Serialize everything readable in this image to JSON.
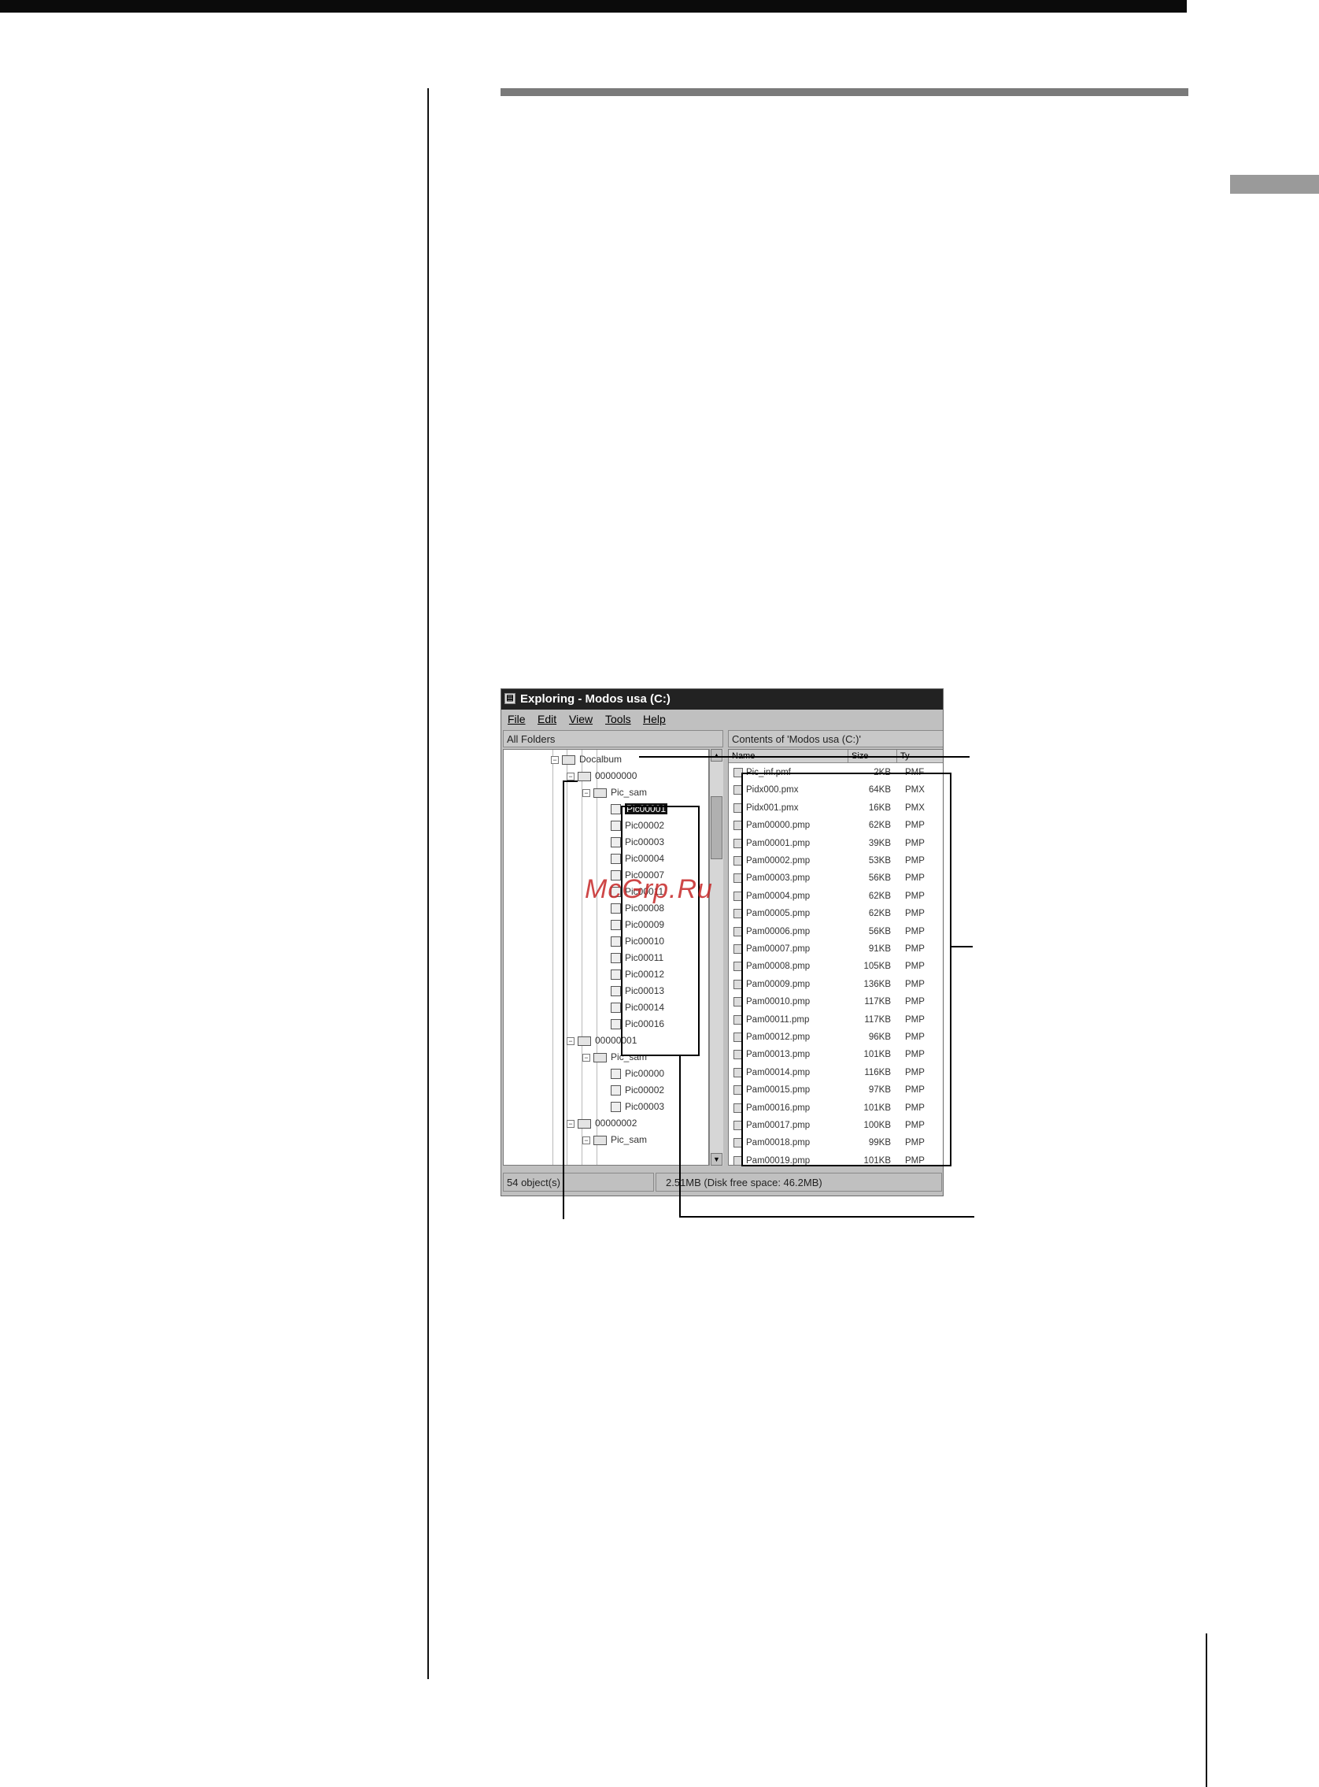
{
  "window": {
    "title": "Exploring - Modos usa (C:)",
    "menu": [
      "File",
      "Edit",
      "View",
      "Tools",
      "Help"
    ],
    "tree_header": "All Folders",
    "list_header": "Contents of 'Modos usa (C:)'",
    "list_columns": [
      "Name",
      "Size",
      "Ty"
    ],
    "tree": [
      {
        "label": "Docalbum",
        "depth": 0,
        "kind": "folder",
        "box": "−"
      },
      {
        "label": "00000000",
        "depth": 1,
        "kind": "folder",
        "box": "−"
      },
      {
        "label": "Pic_sam",
        "depth": 2,
        "kind": "folder",
        "box": "−"
      },
      {
        "label": "Pic00001",
        "depth": 3,
        "kind": "pic",
        "selected": true
      },
      {
        "label": "Pic00002",
        "depth": 3,
        "kind": "pic"
      },
      {
        "label": "Pic00003",
        "depth": 3,
        "kind": "pic"
      },
      {
        "label": "Pic00004",
        "depth": 3,
        "kind": "pic"
      },
      {
        "label": "Pic00007",
        "depth": 3,
        "kind": "pic"
      },
      {
        "label": "Pic00011",
        "depth": 3,
        "kind": "pic"
      },
      {
        "label": "Pic00008",
        "depth": 3,
        "kind": "pic"
      },
      {
        "label": "Pic00009",
        "depth": 3,
        "kind": "pic"
      },
      {
        "label": "Pic00010",
        "depth": 3,
        "kind": "pic"
      },
      {
        "label": "Pic00011",
        "depth": 3,
        "kind": "pic"
      },
      {
        "label": "Pic00012",
        "depth": 3,
        "kind": "pic"
      },
      {
        "label": "Pic00013",
        "depth": 3,
        "kind": "pic"
      },
      {
        "label": "Pic00014",
        "depth": 3,
        "kind": "pic"
      },
      {
        "label": "Pic00016",
        "depth": 3,
        "kind": "pic"
      },
      {
        "label": "00000001",
        "depth": 1,
        "kind": "folder",
        "box": "−"
      },
      {
        "label": "Pic_sam",
        "depth": 2,
        "kind": "folder",
        "box": "−"
      },
      {
        "label": "Pic00000",
        "depth": 3,
        "kind": "pic"
      },
      {
        "label": "Pic00002",
        "depth": 3,
        "kind": "pic"
      },
      {
        "label": "Pic00003",
        "depth": 3,
        "kind": "pic"
      },
      {
        "label": "00000002",
        "depth": 1,
        "kind": "folder",
        "box": "−"
      },
      {
        "label": "Pic_sam",
        "depth": 2,
        "kind": "folder",
        "box": "−"
      }
    ],
    "files": [
      {
        "name": "Pic_inf.pmf",
        "size": "2KB",
        "type": "PMF"
      },
      {
        "name": "Pidx000.pmx",
        "size": "64KB",
        "type": "PMX"
      },
      {
        "name": "Pidx001.pmx",
        "size": "16KB",
        "type": "PMX"
      },
      {
        "name": "Pam00000.pmp",
        "size": "62KB",
        "type": "PMP"
      },
      {
        "name": "Pam00001.pmp",
        "size": "39KB",
        "type": "PMP"
      },
      {
        "name": "Pam00002.pmp",
        "size": "53KB",
        "type": "PMP"
      },
      {
        "name": "Pam00003.pmp",
        "size": "56KB",
        "type": "PMP"
      },
      {
        "name": "Pam00004.pmp",
        "size": "62KB",
        "type": "PMP"
      },
      {
        "name": "Pam00005.pmp",
        "size": "62KB",
        "type": "PMP"
      },
      {
        "name": "Pam00006.pmp",
        "size": "56KB",
        "type": "PMP"
      },
      {
        "name": "Pam00007.pmp",
        "size": "91KB",
        "type": "PMP"
      },
      {
        "name": "Pam00008.pmp",
        "size": "105KB",
        "type": "PMP"
      },
      {
        "name": "Pam00009.pmp",
        "size": "136KB",
        "type": "PMP"
      },
      {
        "name": "Pam00010.pmp",
        "size": "117KB",
        "type": "PMP"
      },
      {
        "name": "Pam00011.pmp",
        "size": "117KB",
        "type": "PMP"
      },
      {
        "name": "Pam00012.pmp",
        "size": "96KB",
        "type": "PMP"
      },
      {
        "name": "Pam00013.pmp",
        "size": "101KB",
        "type": "PMP"
      },
      {
        "name": "Pam00014.pmp",
        "size": "116KB",
        "type": "PMP"
      },
      {
        "name": "Pam00015.pmp",
        "size": "97KB",
        "type": "PMP"
      },
      {
        "name": "Pam00016.pmp",
        "size": "101KB",
        "type": "PMP"
      },
      {
        "name": "Pam00017.pmp",
        "size": "100KB",
        "type": "PMP"
      },
      {
        "name": "Pam00018.pmp",
        "size": "99KB",
        "type": "PMP"
      },
      {
        "name": "Pam00019.pmp",
        "size": "101KB",
        "type": "PMP"
      }
    ],
    "status_left": "54 object(s)",
    "status_right": "2.51MB (Disk free space: 46.2MB)"
  },
  "watermark": "McGrp.Ru",
  "colors": {
    "watermark": "#c62828",
    "titlebar": "#222222",
    "window_face": "#c0c0c0"
  }
}
